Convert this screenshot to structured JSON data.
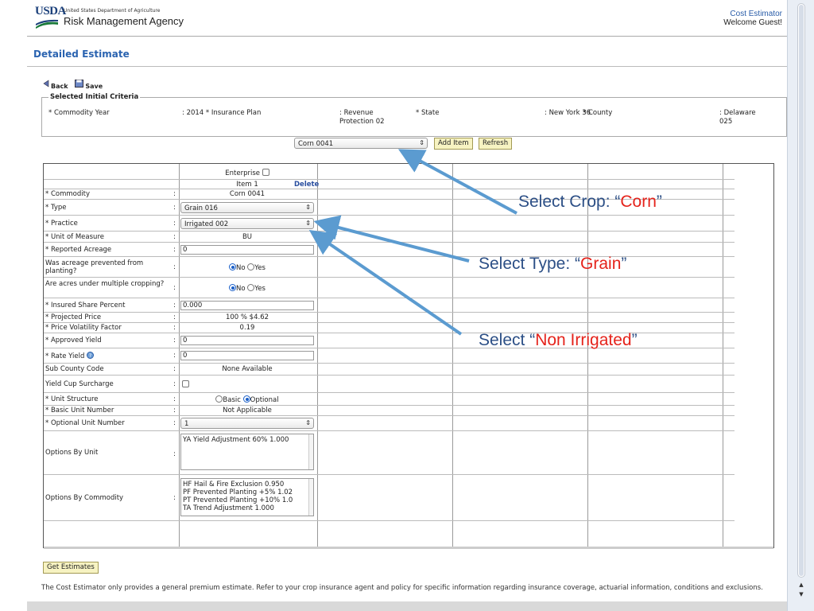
{
  "header": {
    "logo_text": "USDA",
    "dept_name": "United States Department of Agriculture",
    "agency_name": "Risk Management Agency",
    "app_name": "Cost Estimator",
    "welcome": "Welcome Guest!"
  },
  "page_title": "Detailed Estimate",
  "toolbar": {
    "back": "Back",
    "save": "Save"
  },
  "criteria": {
    "legend": "Selected Initial Criteria",
    "commodity_year_label": "* Commodity Year",
    "commodity_year_value": ": 2014 * Insurance Plan",
    "insurance_plan_value": ": Revenue Protection 02",
    "state_label": "* State",
    "state_value": ": New York 36",
    "county_label": "* County",
    "county_value": ": Delaware 025"
  },
  "item_select": {
    "value": "Corn 0041",
    "add_button": "Add Item",
    "refresh_button": "Refresh"
  },
  "grid": {
    "enterprise_label": "Enterprise",
    "item_label": "Item 1",
    "delete_label": "Delete",
    "commodity_label": "* Commodity",
    "commodity_value": "Corn 0041",
    "type_label": "* Type",
    "type_value": "Grain 016",
    "practice_label": "* Practice",
    "practice_value": "Irrigated 002",
    "uom_label": "* Unit of Measure",
    "uom_value": "BU",
    "acreage_label": "* Reported Acreage",
    "acreage_value": "0",
    "prevented_label": "Was acreage prevented from planting?",
    "multiple_label": "Are acres under multiple cropping?",
    "no_label": "No",
    "yes_label": "Yes",
    "share_label": "* Insured Share Percent",
    "share_value": "0.000",
    "price_label": "* Projected Price",
    "price_value": "100 % $4.62",
    "volatility_label": "* Price Volatility Factor",
    "volatility_value": "0.19",
    "approved_label": "* Approved Yield",
    "approved_value": "0",
    "rate_label": "* Rate Yield",
    "rate_value": "0",
    "subcounty_label": "Sub County Code",
    "subcounty_value": "None Available",
    "cup_label": "Yield Cup Surcharge",
    "unit_structure_label": "* Unit Structure",
    "basic_label": "Basic",
    "optional_label": "Optional",
    "basic_unit_label": "* Basic Unit Number",
    "basic_unit_value": "Not Applicable",
    "optional_unit_label": "* Optional Unit Number",
    "optional_unit_value": "1",
    "options_unit_label": "Options By Unit",
    "options_unit_items": [
      "YA Yield Adjustment 60% 1.000"
    ],
    "options_commodity_label": "Options By Commodity",
    "options_commodity_items": [
      "HF Hail & Fire Exclusion 0.950",
      "PF Prevented Planting +5% 1.02",
      "PT Prevented Planting +10% 1.0",
      "TA Trend Adjustment 1.000"
    ]
  },
  "get_estimates": "Get Estimates",
  "footnote": "The Cost Estimator only provides a general premium estimate. Refer to your crop insurance agent and policy for specific information regarding insurance coverage, actuarial information, conditions and exclusions.",
  "annotations": {
    "crop_prefix": "Select Crop: “",
    "crop_value": "Corn",
    "crop_suffix": "”",
    "type_prefix": "Select Type:  “",
    "type_value": "Grain",
    "type_suffix": "”",
    "practice_prefix": "Select  “",
    "practice_value": "Non Irrigated",
    "practice_suffix": "”",
    "arrow_color": "#5b9bd0",
    "accent_color": "#e5231b"
  }
}
